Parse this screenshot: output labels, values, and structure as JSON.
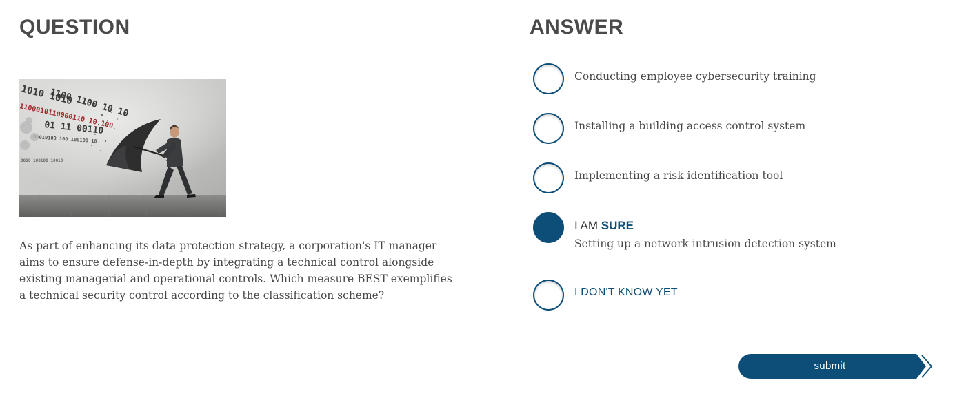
{
  "question": {
    "heading": "QUESTION",
    "text": "As part of enhancing its data protection strategy, a corporation's IT manager aims to ensure defense-in-depth by integrating a technical control alongside existing managerial and operational controls. Which measure BEST exemplifies a technical security control according to the classification scheme?",
    "image": {
      "icon": "man-with-umbrella-blocking-binary-stream-illustration",
      "binary_rows": [
        "1010 1010",
        "1100 1100 10 10",
        "1100010110000110 10 100",
        "01 11 00110",
        "00010100 100 100100 10",
        "0010 100100 10010"
      ]
    }
  },
  "answer": {
    "heading": "ANSWER",
    "options": [
      {
        "label": "Conducting employee cybersecurity training",
        "selected": false
      },
      {
        "label": "Installing a building access control system",
        "selected": false
      },
      {
        "label": "Implementing a risk identification tool",
        "selected": false
      }
    ],
    "confidence": {
      "prefix": "I AM",
      "emphasis": "SURE",
      "selected_answer": "Setting up a network intrusion detection system",
      "selected": true
    },
    "dont_know": {
      "label": "I DON'T KNOW YET",
      "selected": false
    },
    "submit_label": "submit"
  },
  "colors": {
    "accent": "#0d4e78",
    "heading": "#4a4a4a",
    "body_text": "#474747",
    "rule": "#cfcfcf"
  }
}
